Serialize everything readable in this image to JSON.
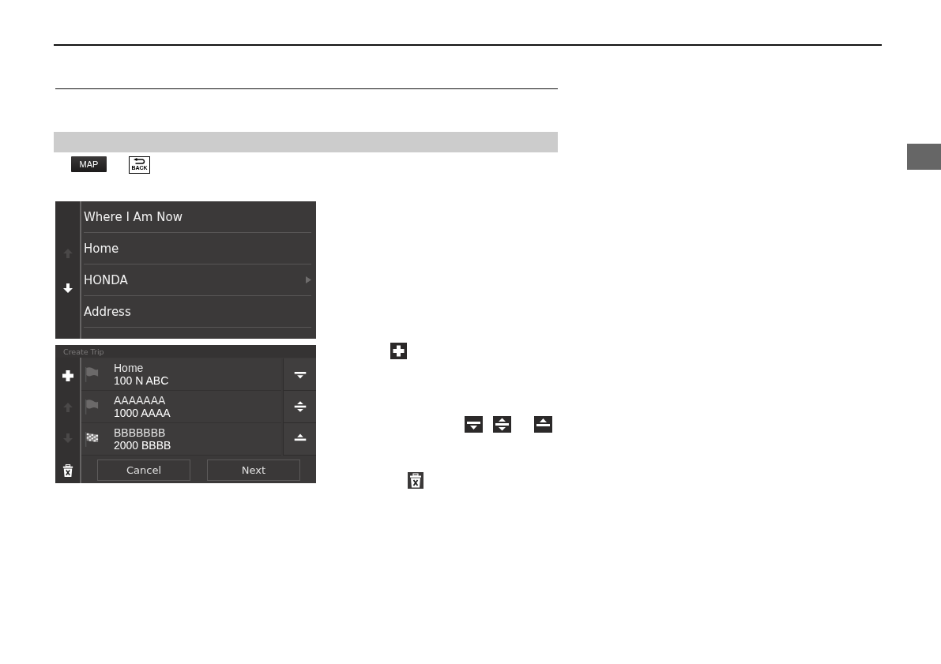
{
  "key_icons": [
    {
      "kind": "map",
      "label": "MAP"
    },
    {
      "kind": "back",
      "label": "BACK"
    }
  ],
  "screen_1": {
    "scroll_buttons": [
      {
        "kind": "up",
        "disabled": true
      },
      {
        "kind": "down",
        "disabled": false
      }
    ],
    "rows": [
      {
        "label": "Where I Am Now",
        "has_submenu": false
      },
      {
        "label": "Home",
        "has_submenu": false
      },
      {
        "label": "HONDA",
        "has_submenu": true
      },
      {
        "label": "Address",
        "has_submenu": false
      }
    ]
  },
  "screen_2": {
    "title": "Create Trip",
    "side_buttons": [
      {
        "kind": "add",
        "disabled": false
      },
      {
        "kind": "up",
        "disabled": true
      },
      {
        "kind": "down",
        "disabled": true
      },
      {
        "kind": "delete",
        "disabled": false
      }
    ],
    "destinations": [
      {
        "kind": "waypoint",
        "name": "Home",
        "address": "100 N ABC"
      },
      {
        "kind": "waypoint",
        "name": "AAAAAAA",
        "address": "1000 AAAA"
      },
      {
        "kind": "finish",
        "name": "BBBBBBB",
        "address": "2000 BBBB"
      }
    ],
    "move_buttons": [
      {
        "kind": "down"
      },
      {
        "kind": "both"
      },
      {
        "kind": "up"
      }
    ],
    "buttons": [
      {
        "label": "Cancel"
      },
      {
        "label": "Next"
      }
    ]
  },
  "steps": [
    {
      "icons": [
        {
          "kind": "add"
        }
      ]
    },
    {
      "icons": [
        {
          "kind": "move_down"
        },
        {
          "kind": "move_both"
        },
        {
          "kind": "move_up"
        }
      ]
    },
    {
      "icons": [
        {
          "kind": "delete"
        }
      ]
    }
  ]
}
